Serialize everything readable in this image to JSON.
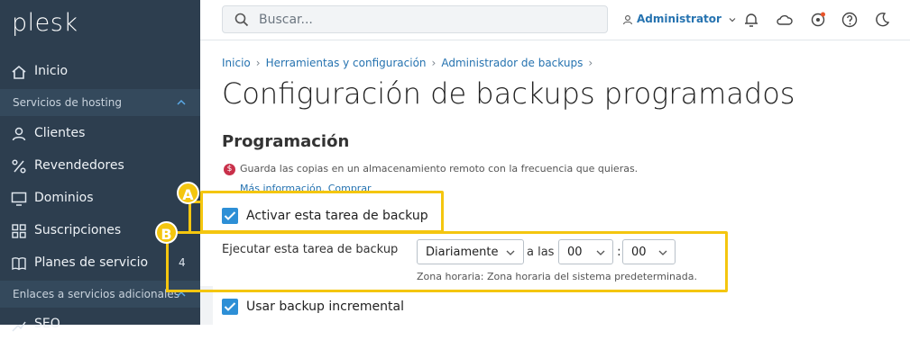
{
  "brand": {
    "logo": "plesk"
  },
  "search": {
    "placeholder": "Buscar..."
  },
  "user": {
    "name": "Administrator"
  },
  "sidebar": {
    "home": "Inicio",
    "section_hosting": "Servicios de hosting",
    "items": [
      {
        "label": "Clientes",
        "icon": "user-icon"
      },
      {
        "label": "Revendedores",
        "icon": "percent-icon"
      },
      {
        "label": "Dominios",
        "icon": "monitor-icon"
      },
      {
        "label": "Suscripciones",
        "icon": "grid-icon"
      },
      {
        "label": "Planes de servicio",
        "icon": "book-icon",
        "count": "4"
      }
    ],
    "section_links": "Enlaces a servicios adicionales",
    "seo": "SEO"
  },
  "breadcrumb": [
    "Inicio",
    "Herramientas y configuración",
    "Administrador de backups"
  ],
  "page": {
    "title": "Configuración de backups programados",
    "section": "Programación",
    "promo_text": "Guarda las copias en un almacenamiento remoto con la frecuencia que quieras.",
    "promo_more": "Más información.",
    "promo_buy": "Comprar"
  },
  "form": {
    "activate_label": "Activar esta tarea de backup",
    "run_label": "Ejecutar esta tarea de backup",
    "frequency": "Diariamente",
    "at_label": "a las",
    "hour": "00",
    "colon": ":",
    "minute": "00",
    "timezone_note": "Zona horaria: Zona horaria del sistema predeterminada.",
    "incremental_label": "Usar backup incremental"
  },
  "annotations": {
    "a": "A",
    "b": "B"
  },
  "colors": {
    "sidebar_bg": "#2d3e4f",
    "accent": "#2d8fd6",
    "link": "#2673b0",
    "highlight": "#f4c60f"
  }
}
